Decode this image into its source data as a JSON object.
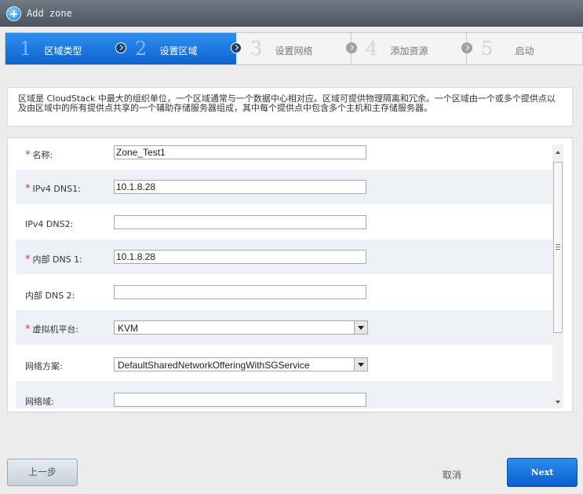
{
  "window": {
    "title": "Add zone"
  },
  "steps": [
    {
      "num": "1",
      "label": "区域类型",
      "active": true
    },
    {
      "num": "2",
      "label": "设置区域",
      "active": true
    },
    {
      "num": "3",
      "label": "设置网络",
      "active": false
    },
    {
      "num": "4",
      "label": "添加资源",
      "active": false
    },
    {
      "num": "5",
      "label": "启动",
      "active": false
    }
  ],
  "info": {
    "text": "区域是 CloudStack 中最大的组织单位，一个区域通常与一个数据中心相对应。区域可提供物理隔离和冗余。一个区域由一个或多个提供点以及由区域中的所有提供点共享的一个辅助存储服务器组成，其中每个提供点中包含多个主机和主存储服务器。"
  },
  "form": {
    "required_mark": "*",
    "name": {
      "label": "名称:",
      "value": "Zone_Test1"
    },
    "ipv4_dns1": {
      "label": "IPv4 DNS1:",
      "value": "10.1.8.28"
    },
    "ipv4_dns2": {
      "label": "IPv4 DNS2:",
      "value": ""
    },
    "internal_dns1": {
      "label": "内部 DNS 1:",
      "value": "10.1.8.28"
    },
    "internal_dns2": {
      "label": "内部 DNS 2:",
      "value": ""
    },
    "hypervisor": {
      "label": "虚拟机平台:",
      "value": "KVM"
    },
    "network_offering": {
      "label": "网络方案:",
      "value": "DefaultSharedNetworkOfferingWithSGService"
    },
    "network_domain": {
      "label": "网络域:",
      "value": ""
    }
  },
  "footer": {
    "prev_label": "上一步",
    "cancel_label": "取消",
    "next_label": "Next"
  },
  "colors": {
    "accent": "#1a78e0",
    "required": "#d9322b"
  }
}
